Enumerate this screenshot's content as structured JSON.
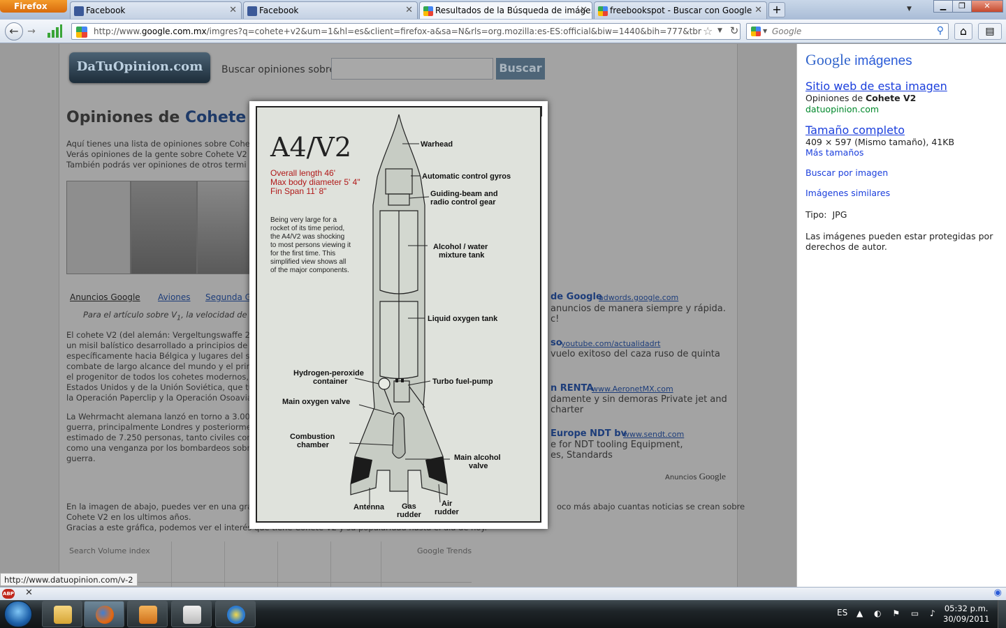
{
  "browser": {
    "app_button": "Firefox",
    "tabs": [
      {
        "label": "Facebook",
        "active": false
      },
      {
        "label": "Facebook",
        "active": false
      },
      {
        "label": "Resultados de la Búsqueda de imáge...",
        "active": true
      },
      {
        "label": "freebookspot - Buscar con Google",
        "active": false
      }
    ],
    "url_prefix": "http://www.",
    "url_domain": "google.com.mx",
    "url_rest": "/imgres?q=cohete+v2&um=1&hl=es&client=firefox-a&sa=N&rls=org.mozilla:es-ES:official&biw=1440&bih=777&tbm=isch&tbnid=pr",
    "search_placeholder": "Google",
    "status_url": "http://www.datuopinion.com/v-2"
  },
  "site": {
    "logo": "DaTuOpinion.com",
    "search_label": "Buscar opiniones sobre:",
    "search_button": "Buscar",
    "title_prefix": "Opiniones de ",
    "title_topic": "Cohete V",
    "intro": [
      "Aquí tienes una lista de opiniones sobre Cohete",
      "Verás opiniones de la gente sobre Cohete V2 y c",
      "También podrás ver opiniones de otros termi"
    ],
    "links": [
      "Anuncios Google",
      "Aviones",
      "Segunda Gu"
    ],
    "quote": "Para el artículo sobre V",
    "quote_sub": "1",
    "quote_end": ", la velocidad de",
    "para1": [
      "El cohete V2 (del alemán: Vergeltungswaffe 2, «",
      "un misil balístico desarrollado a principios de la",
      "específicamente hacia Bélgica y lugares del sud",
      "combate de largo alcance del mundo y el primer",
      "el progenitor de todos los cohetes modernos, in",
      "Estados Unidos y de la Unión Soviética, que tuvi",
      "la Operación Paperclip y la Operación Osoaviak"
    ],
    "para2": [
      "La Wehrmacht alemana lanzó en torno a 3.000 c",
      "guerra, principalmente Londres y posteriorment",
      "estimado de 7.250 personas, tanto civiles como",
      "como una venganza por los bombardeos sobre",
      "guerra."
    ],
    "para3": [
      "En la imagen de abajo, puedes ver en una gráfic",
      "Cohete V2 en los ultimos años.",
      "Gracias a este gráfica, podemos ver el interés que tiene Cohete V2 y su popularidad hasta el día de hoy."
    ],
    "para3_right": "oco más abajo cuantas noticias se crean sobre",
    "chart_left": "Search Volume index",
    "chart_right": "Google Trends",
    "ads": [
      {
        "title": "de Google",
        "url": "adwords.google.com",
        "lines": [
          "anuncios de manera siempre y rápida.",
          "c!"
        ]
      },
      {
        "title": "so",
        "url": "youtube.com/actualidadrt",
        "lines": [
          "vuelo exitoso del caza ruso de quinta"
        ]
      },
      {
        "title": "n RENTA",
        "url": "www.AeronetMX.com",
        "lines": [
          "damente y sin demoras Private jet and",
          "charter"
        ]
      },
      {
        "title": "Europe NDT bv",
        "url": "www.sendt.com",
        "lines": [
          "e for NDT tooling Equipment,",
          "es, Standards"
        ]
      }
    ],
    "ads_footer": "Anuncios",
    "ads_footer_brand": "Google"
  },
  "modal": {
    "close": "✕",
    "art_title": "A4/V2",
    "specs": [
      "Overall length 46'",
      "Max body diameter 5' 4\"",
      "Fin Span 11' 8\""
    ],
    "description": [
      "Being very large for a",
      "rocket of its time period,",
      "the A4/V2 was shocking",
      "to most persons viewing it",
      "for the first time. This",
      "simplified view shows all",
      "of the major components."
    ],
    "labels": {
      "warhead": "Warhead",
      "gyros": "Automatic control gyros",
      "guiding1": "Guiding-beam and",
      "guiding2": "radio control gear",
      "alcohol1": "Alcohol / water",
      "alcohol2": "mixture tank",
      "lox": "Liquid oxygen tank",
      "h2o2_1": "Hydrogen-peroxide",
      "h2o2_2": "container",
      "turbo": "Turbo fuel-pump",
      "oxvalve": "Main oxygen valve",
      "comb1": "Combustion",
      "comb2": "chamber",
      "alcvalve1": "Main alcohol",
      "alcvalve2": "valve",
      "antenna": "Antenna",
      "gas1": "Gas",
      "gas2": "rudder",
      "air1": "Air",
      "air2": "rudder"
    }
  },
  "details": {
    "brand": "Google",
    "brand_suffix": "imágenes",
    "site_link": "Sitio web de esta imagen",
    "site_desc_prefix": "Opiniones de ",
    "site_desc_bold": "Cohete V2",
    "site_domain": "datuopinion.com",
    "full_size": "Tamaño completo",
    "dims": "409 × 597 (Mismo tamaño), 41KB",
    "more_sizes": "Más tamaños",
    "search_by_image": "Buscar por imagen",
    "similar": "Imágenes similares",
    "type_label": "Tipo:",
    "type_value": "JPG",
    "copyright": [
      "Las imágenes pueden estar protegidas por",
      "derechos de autor."
    ]
  },
  "taskbar": {
    "lang": "ES",
    "time": "05:32 p.m.",
    "date": "30/09/2011",
    "apps": [
      "explorer-icon",
      "firefox-icon",
      "media-player-icon",
      "editor-icon",
      "arch-app-icon"
    ]
  },
  "colors": {
    "accent": "#1a3edc",
    "url_green": "#00882b",
    "firefox_orange": "#e07b15"
  }
}
